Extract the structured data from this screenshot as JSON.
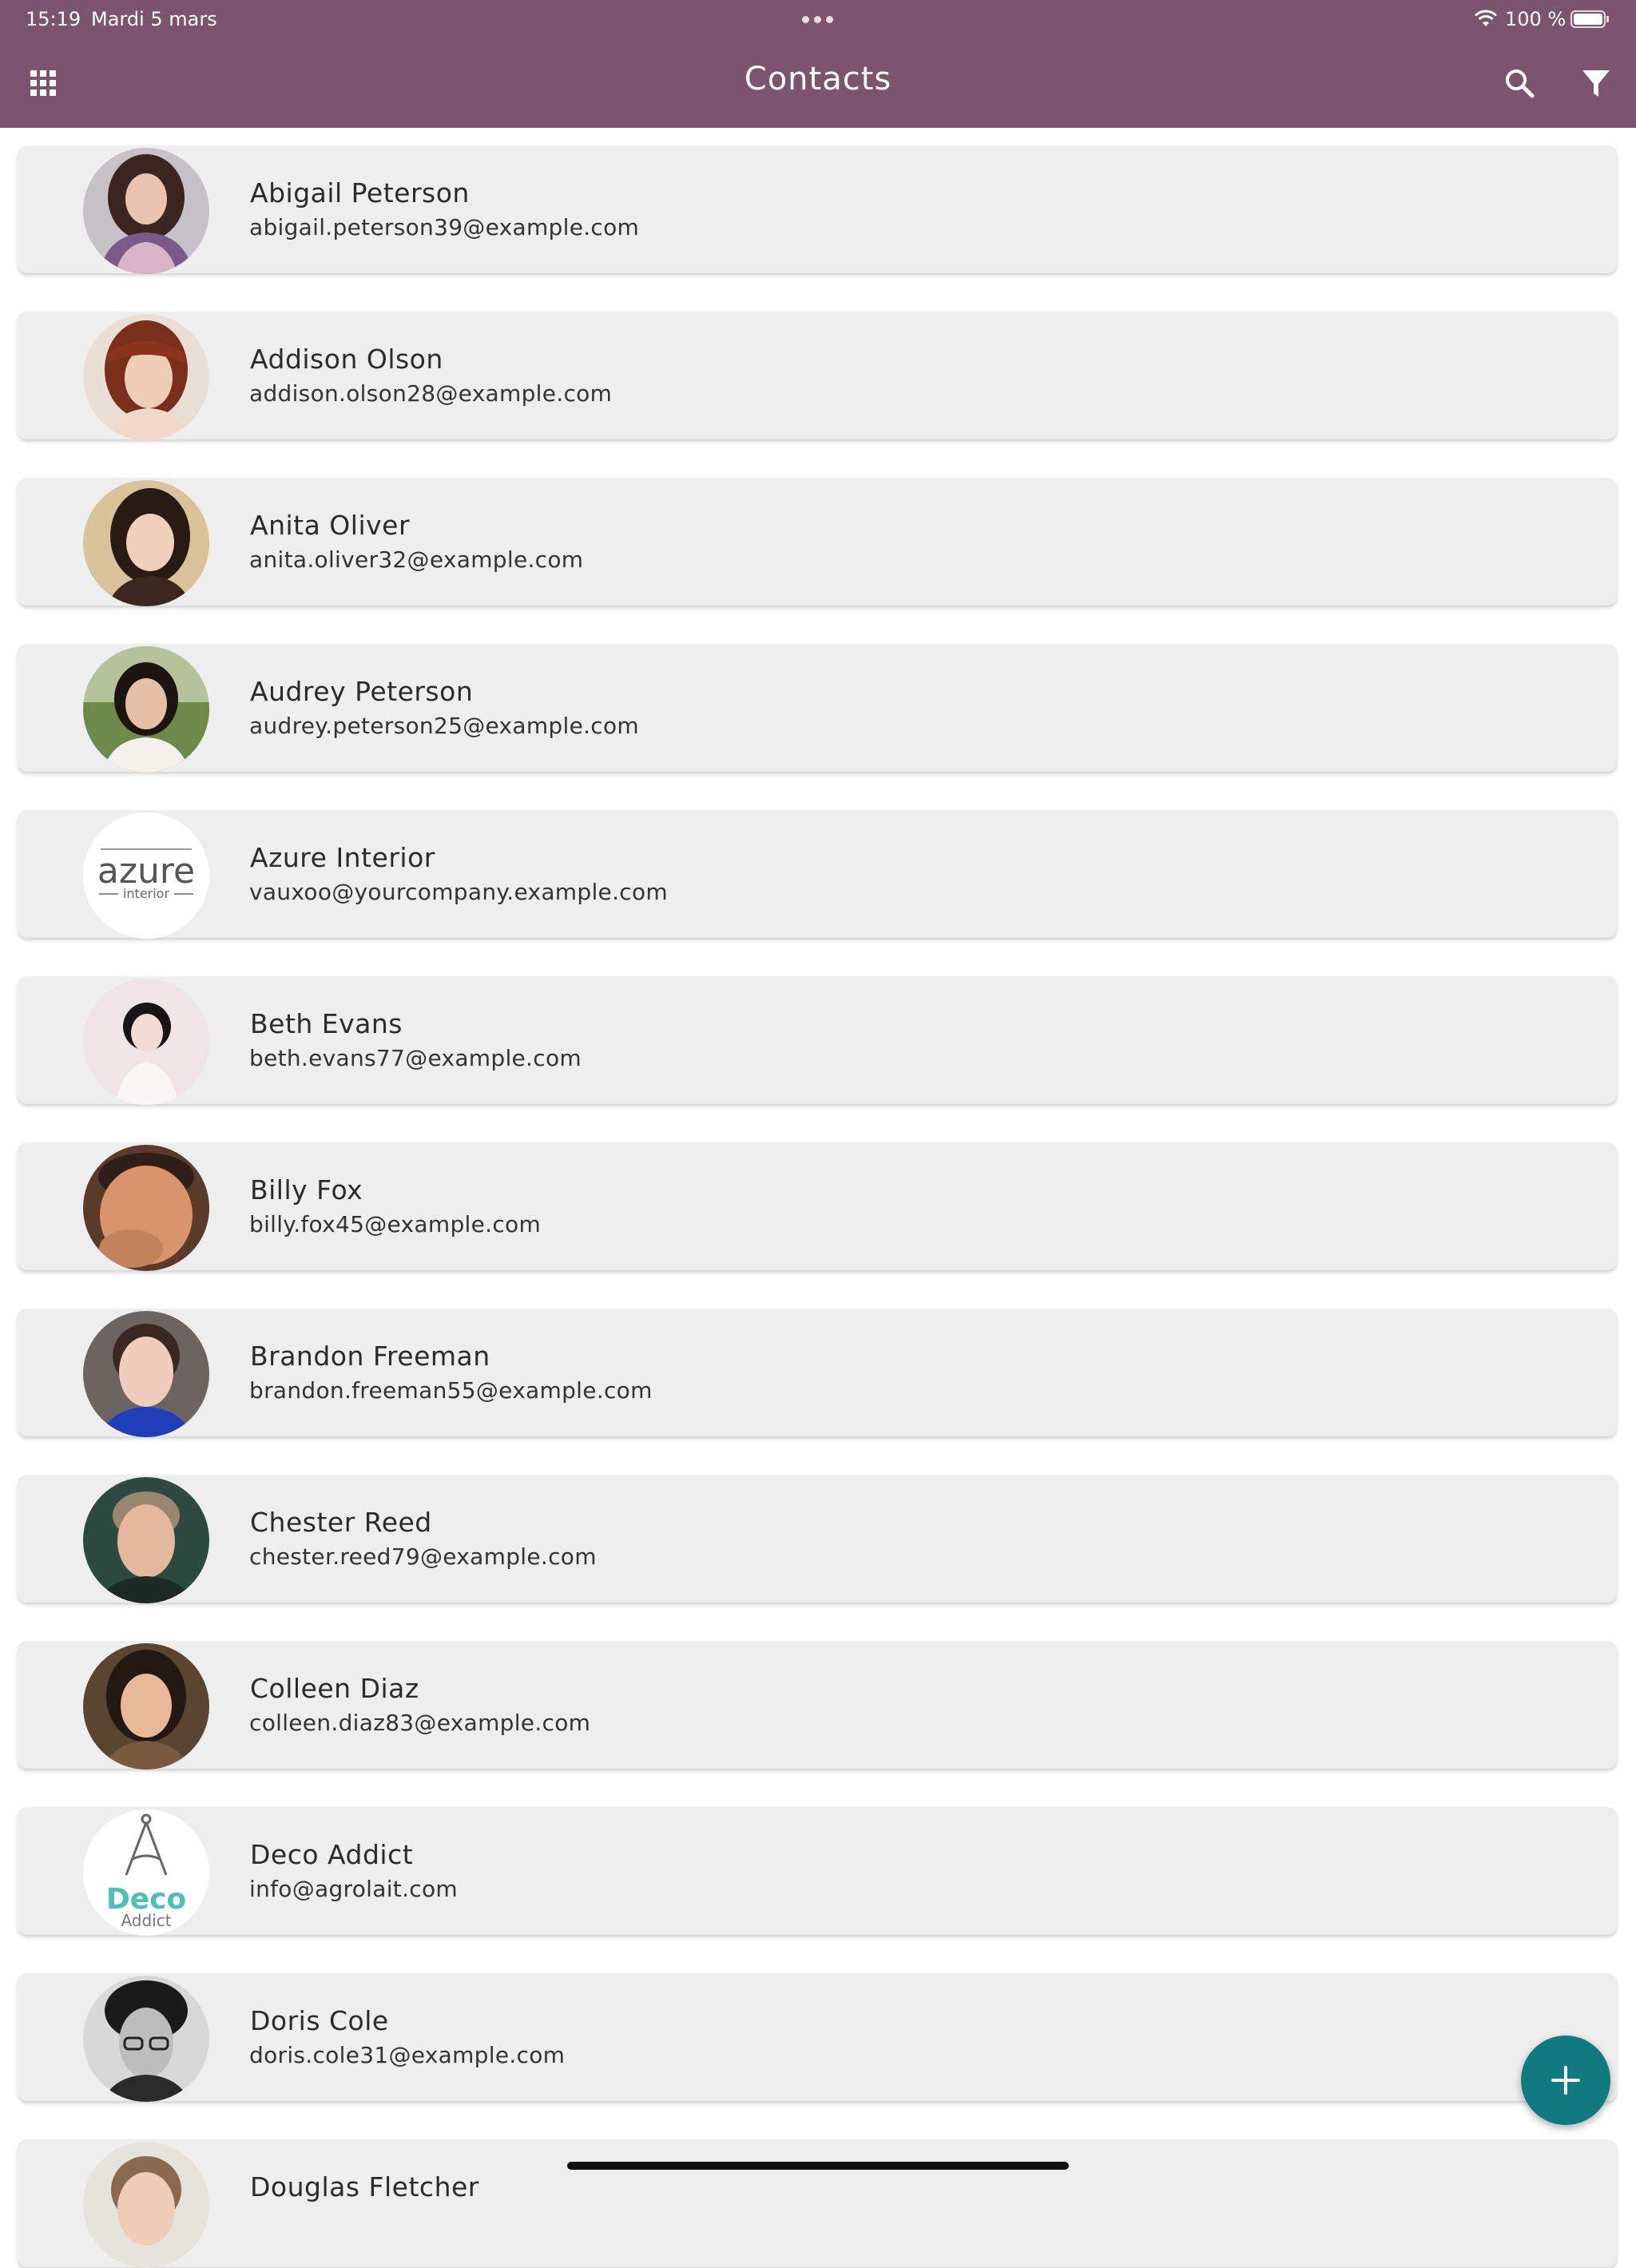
{
  "status_bar": {
    "time": "15:19",
    "date": "Mardi 5 mars",
    "battery": "100 %"
  },
  "header": {
    "title": "Contacts",
    "icons": [
      "apps-grid-icon",
      "search-icon",
      "filter-icon"
    ]
  },
  "colors": {
    "header_bg": "#7c5470",
    "card_bg": "#efeeef",
    "fab_bg": "#117a80"
  },
  "contacts": [
    {
      "name": "Abigail Peterson",
      "email": "abigail.peterson39@example.com",
      "avatar": "photo"
    },
    {
      "name": "Addison Olson",
      "email": "addison.olson28@example.com",
      "avatar": "photo"
    },
    {
      "name": "Anita Oliver",
      "email": "anita.oliver32@example.com",
      "avatar": "photo"
    },
    {
      "name": "Audrey Peterson",
      "email": "audrey.peterson25@example.com",
      "avatar": "photo"
    },
    {
      "name": "Azure Interior",
      "email": "vauxoo@yourcompany.example.com",
      "avatar": "logo",
      "logo_text": "azure",
      "logo_sub": "interior"
    },
    {
      "name": "Beth Evans",
      "email": "beth.evans77@example.com",
      "avatar": "photo"
    },
    {
      "name": "Billy Fox",
      "email": "billy.fox45@example.com",
      "avatar": "photo"
    },
    {
      "name": "Brandon Freeman",
      "email": "brandon.freeman55@example.com",
      "avatar": "photo"
    },
    {
      "name": "Chester Reed",
      "email": "chester.reed79@example.com",
      "avatar": "photo"
    },
    {
      "name": "Colleen Diaz",
      "email": "colleen.diaz83@example.com",
      "avatar": "photo"
    },
    {
      "name": "Deco Addict",
      "email": "info@agrolait.com",
      "avatar": "logo",
      "logo_text": "Deco",
      "logo_sub": "Addict"
    },
    {
      "name": "Doris Cole",
      "email": "doris.cole31@example.com",
      "avatar": "photo"
    },
    {
      "name": "Douglas Fletcher",
      "email": "",
      "avatar": "photo"
    }
  ],
  "fab": {
    "icon": "plus-icon",
    "action": "add-contact"
  }
}
